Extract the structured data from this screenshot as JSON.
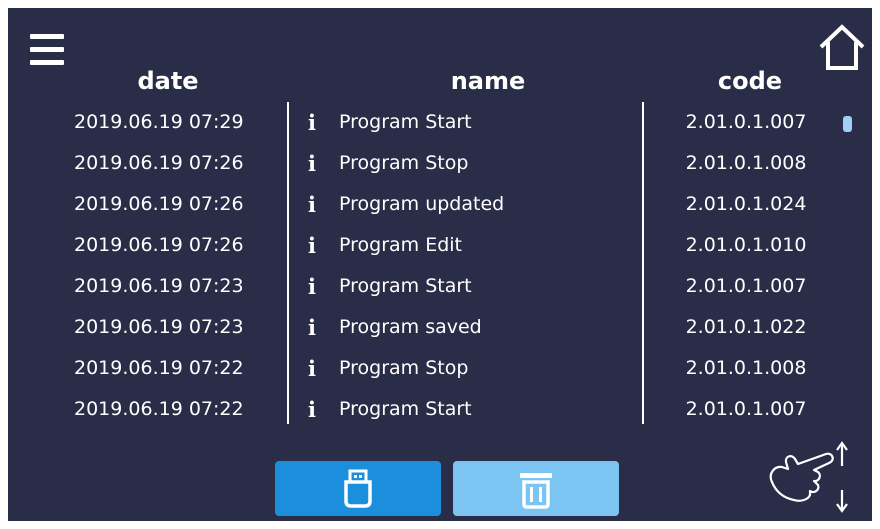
{
  "header": {
    "date": "date",
    "name": "name",
    "code": "code"
  },
  "log": [
    {
      "date": "2019.06.19  07:29",
      "icon": "info-icon",
      "name": "Program Start",
      "code": "2.01.0.1.007"
    },
    {
      "date": "2019.06.19  07:26",
      "icon": "info-icon",
      "name": "Program Stop",
      "code": "2.01.0.1.008"
    },
    {
      "date": "2019.06.19  07:26",
      "icon": "info-icon",
      "name": "Program updated",
      "code": "2.01.0.1.024"
    },
    {
      "date": "2019.06.19  07:26",
      "icon": "info-icon",
      "name": "Program Edit",
      "code": "2.01.0.1.010"
    },
    {
      "date": "2019.06.19  07:23",
      "icon": "info-icon",
      "name": "Program Start",
      "code": "2.01.0.1.007"
    },
    {
      "date": "2019.06.19  07:23",
      "icon": "info-icon",
      "name": "Program saved",
      "code": "2.01.0.1.022"
    },
    {
      "date": "2019.06.19  07:22",
      "icon": "info-icon",
      "name": "Program Stop",
      "code": "2.01.0.1.008"
    },
    {
      "date": "2019.06.19  07:22",
      "icon": "info-icon",
      "name": "Program Start",
      "code": "2.01.0.1.007"
    }
  ],
  "icons": {
    "menu": "hamburger-menu-icon",
    "home": "home-icon",
    "export": "usb-drive-icon",
    "delete": "trash-icon",
    "gesture": "swipe-vertical-icon",
    "row": "info-icon"
  },
  "colors": {
    "background": "#2a2d48",
    "text": "#ffffff",
    "export_button": "#1b8fdc",
    "delete_button": "#7cc5f2",
    "scrollbar": "#9fd0f2"
  }
}
